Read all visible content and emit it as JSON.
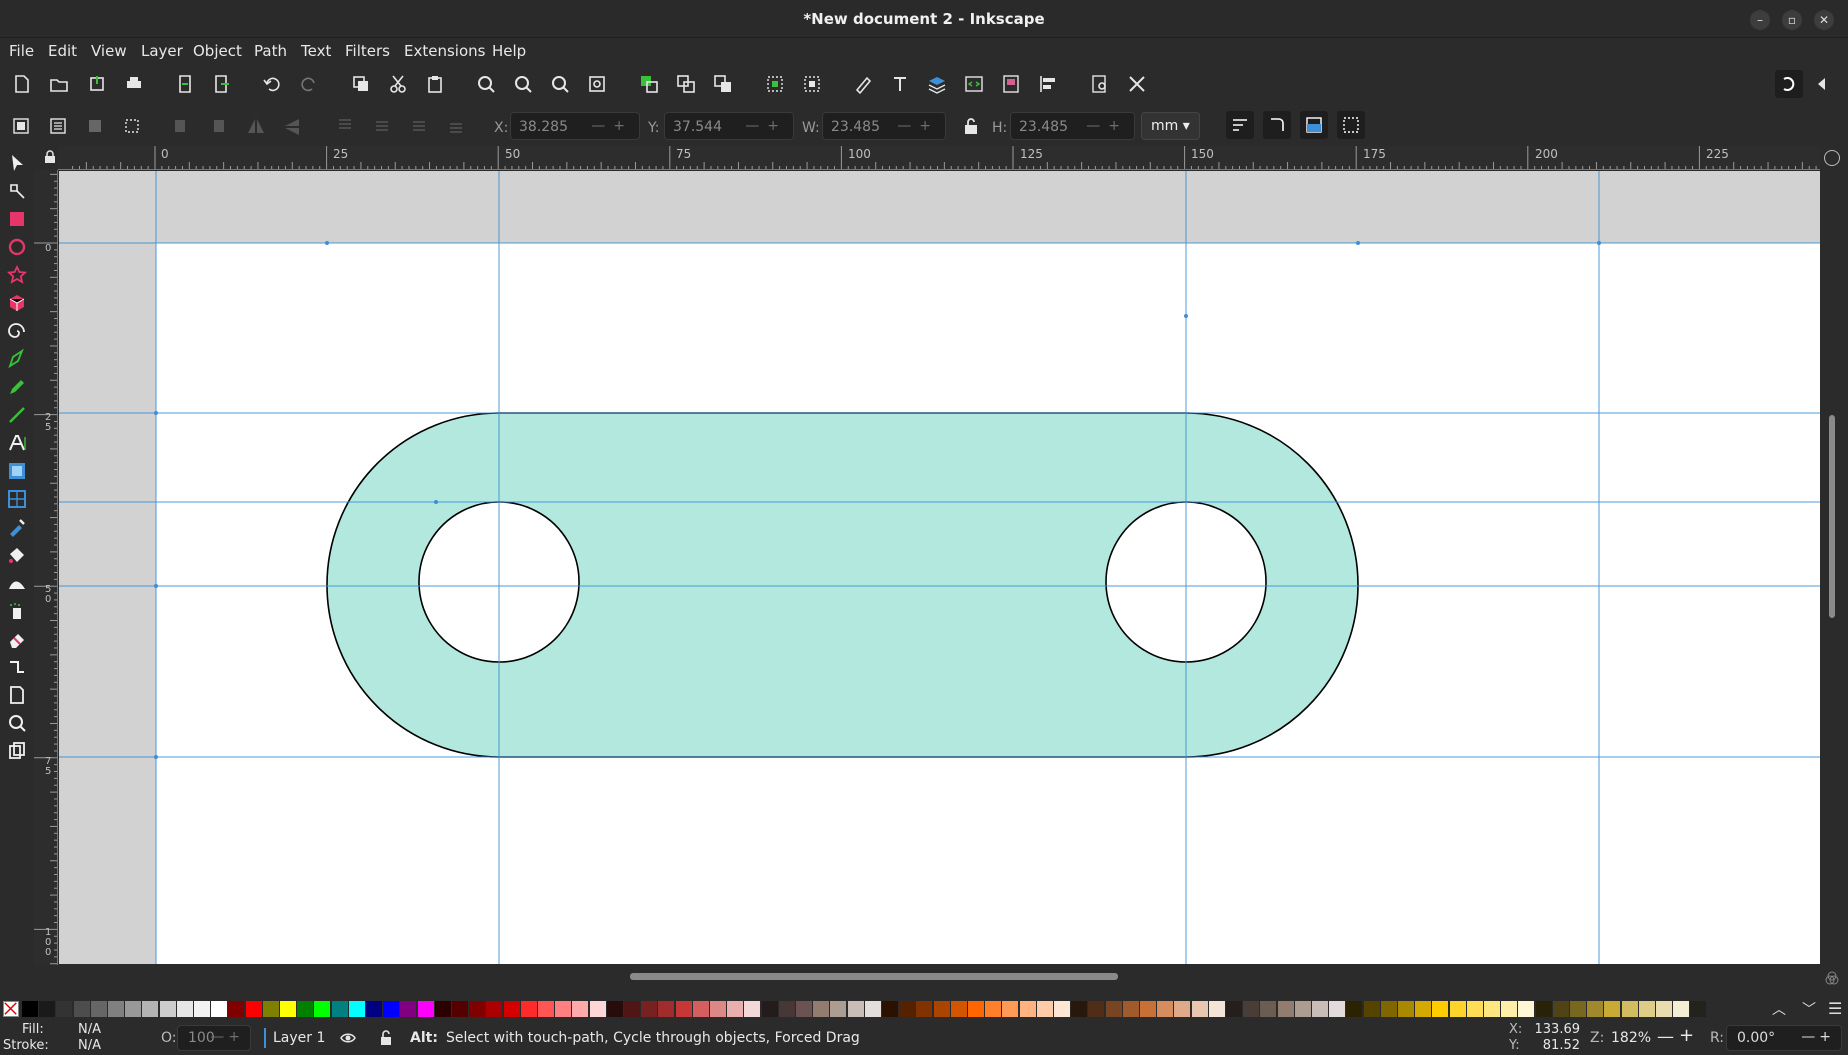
{
  "window": {
    "title": "*New document 2 - Inkscape"
  },
  "menu": [
    "File",
    "Edit",
    "View",
    "Layer",
    "Object",
    "Path",
    "Text",
    "Filters",
    "Extensions",
    "Help"
  ],
  "controls": {
    "x_label": "X:",
    "x_value": "38.285",
    "y_label": "Y:",
    "y_value": "37.544",
    "w_label": "W:",
    "w_value": "23.485",
    "h_label": "H:",
    "h_value": "23.485",
    "unit": "mm"
  },
  "hruler_labels": [
    "0",
    "25",
    "50",
    "75",
    "100",
    "125",
    "150",
    "175",
    "200",
    "225"
  ],
  "vruler_labels": [
    "0",
    "2 5",
    "5 0",
    "7 5",
    "1 0 0"
  ],
  "status": {
    "fill_label": "Fill:",
    "fill_value": "N/A",
    "stroke_label": "Stroke:",
    "stroke_value": "N/A",
    "opacity_label": "O:",
    "opacity_value": "100",
    "layer": "Layer 1",
    "message_bold": "Alt:",
    "message": "Select with touch-path, Cycle through objects, Forced Drag",
    "cursor_x_label": "X:",
    "cursor_x": "133.69",
    "cursor_y_label": "Y:",
    "cursor_y": "81.52",
    "zoom_label": "Z:",
    "zoom": "182%",
    "rotate_label": "R:",
    "rotate": "0.00°"
  },
  "colors": {
    "shape_fill": "#b2e8de",
    "shape_stroke": "#000000",
    "guide": "#3d8fd6",
    "page": "#ffffff",
    "desk": "#d2d2d2"
  },
  "palette": [
    "#000000",
    "#1a1a1a",
    "#333333",
    "#4d4d4d",
    "#666666",
    "#808080",
    "#999999",
    "#b3b3b3",
    "#cccccc",
    "#e6e6e6",
    "#f2f2f2",
    "#ffffff",
    "#800000",
    "#ff0000",
    "#808000",
    "#ffff00",
    "#008000",
    "#00ff00",
    "#008080",
    "#00ffff",
    "#000080",
    "#0000ff",
    "#800080",
    "#ff00ff",
    "#2b0000",
    "#550000",
    "#800000",
    "#aa0000",
    "#d40000",
    "#ff2a2a",
    "#ff5555",
    "#ff8080",
    "#ffaaaa",
    "#ffd5d5",
    "#280b0b",
    "#501616",
    "#782121",
    "#a02c2c",
    "#c83737",
    "#d35f5f",
    "#de8787",
    "#e9afaf",
    "#f4d7d7",
    "#241c1c",
    "#483737",
    "#6c5353",
    "#917c6f",
    "#ac9d93",
    "#c8beb7",
    "#e3dedb",
    "#2b1100",
    "#552200",
    "#803300",
    "#aa4400",
    "#d45500",
    "#ff6600",
    "#ff7f2a",
    "#ff9955",
    "#ffb380",
    "#ffccaa",
    "#ffe6d5",
    "#28170b",
    "#502d16",
    "#784421",
    "#a05a2c",
    "#c87137",
    "#d38d5f",
    "#deaa87",
    "#e9c6af",
    "#f4e3d7",
    "#241f1c",
    "#483e37",
    "#6c5d53",
    "#917c6f",
    "#ac9d93",
    "#c8beb7",
    "#e3dbdb",
    "#2b2200",
    "#554400",
    "#806600",
    "#aa8800",
    "#d4aa00",
    "#ffcc00",
    "#ffd42a",
    "#ffdd55",
    "#ffe680",
    "#ffeeaa",
    "#fff6d5",
    "#28220b",
    "#504416",
    "#786721",
    "#a0892c",
    "#c8ab37",
    "#d3bc5f",
    "#decd87",
    "#e9ddaf",
    "#f4eed7",
    "#24221c"
  ]
}
